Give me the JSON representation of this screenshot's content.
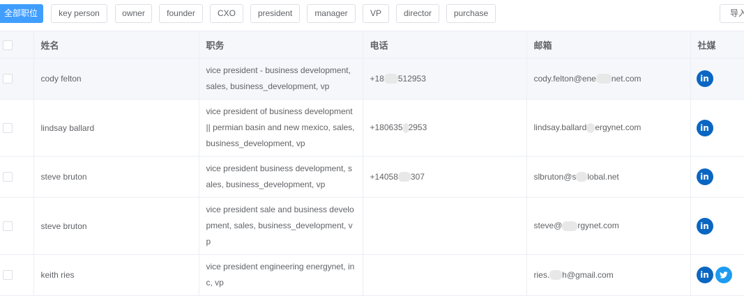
{
  "filters": {
    "chips": [
      {
        "label": "全部职位",
        "active": true
      },
      {
        "label": "key person"
      },
      {
        "label": "owner"
      },
      {
        "label": "founder"
      },
      {
        "label": "CXO"
      },
      {
        "label": "president"
      },
      {
        "label": "manager"
      },
      {
        "label": "VP"
      },
      {
        "label": "director"
      },
      {
        "label": "purchase"
      }
    ],
    "import_label": "导入"
  },
  "table": {
    "headers": {
      "name": "姓名",
      "title": "职务",
      "phone": "电话",
      "email": "邮箱",
      "social": "社媒"
    },
    "rows": [
      {
        "name": "cody felton",
        "title": "vice president - business development, sales, business_development, vp",
        "phone_a": "+18",
        "phone_b": "512953",
        "email_a": "cody.felton@ene",
        "email_b": "net.com",
        "social": [
          "linkedin-icon"
        ]
      },
      {
        "name": "lindsay ballard",
        "title": "vice president of business development || permian basin and new mexico, sales, business_development, vp",
        "phone_a": "+180635",
        "phone_b": "2953",
        "email_a": "lindsay.ballard",
        "email_b": "ergynet.com",
        "social": [
          "linkedin-icon"
        ]
      },
      {
        "name": "steve bruton",
        "title": "vice president business development, sales, business_development, vp",
        "phone_a": "+14058",
        "phone_b": "307",
        "email_a": "slbruton@s",
        "email_b": "lobal.net",
        "social": [
          "linkedin-icon"
        ]
      },
      {
        "name": "steve bruton",
        "title": "vice president sale and business development, sales, business_development, vp",
        "phone_a": "",
        "phone_b": "",
        "email_a": "steve@",
        "email_b": "rgynet.com",
        "social": [
          "linkedin-icon"
        ]
      },
      {
        "name": "keith ries",
        "title": "vice president engineering energynet, inc, vp",
        "phone_a": "",
        "phone_b": "",
        "email_a": "ries.",
        "email_b": "h@gmail.com",
        "social": [
          "linkedin-icon",
          "twitter-icon"
        ]
      }
    ]
  },
  "colors": {
    "accent": "#409eff",
    "linkedin": "#0a66c2",
    "twitter": "#1d9bf0",
    "header_bg": "#f5f7fa"
  }
}
